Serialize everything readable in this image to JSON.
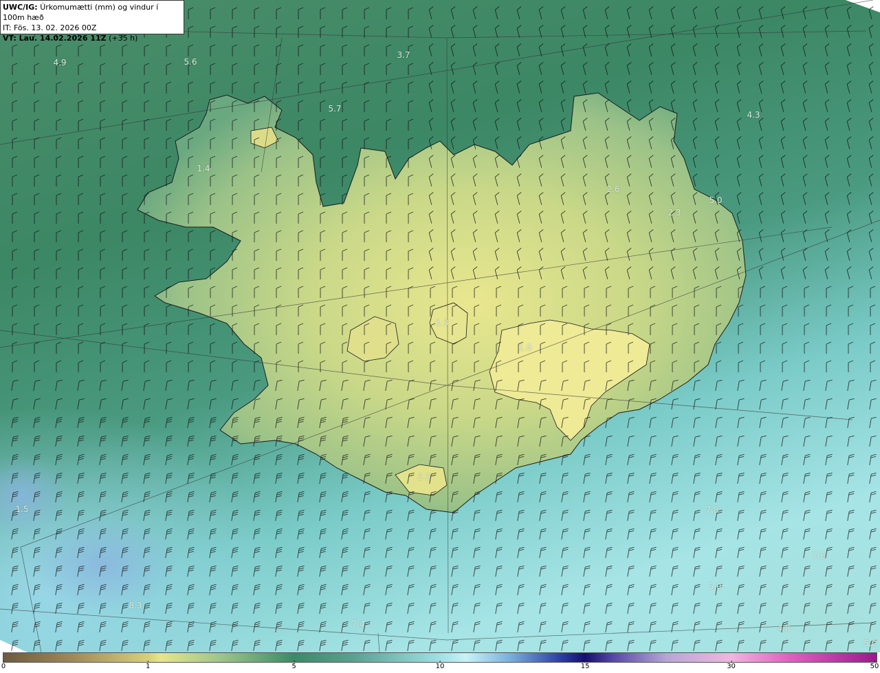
{
  "title": {
    "product": "UWC/IG:",
    "description": "Úrkomumætti (mm) og vindur í 100m hæð",
    "init_time": "IT: Fös. 13. 02. 2026 00Z",
    "valid_prefix": "VT: Lau. 14.02.2026 11Z",
    "valid_suffix": "(+35 h)"
  },
  "value_labels": [
    {
      "text": "4.9"
    },
    {
      "text": "5.6"
    },
    {
      "text": "3.7"
    },
    {
      "text": "5.7"
    },
    {
      "text": "4.3"
    },
    {
      "text": "2.6"
    },
    {
      "text": "5.0"
    },
    {
      "text": "2.3"
    },
    {
      "text": "1.4"
    },
    {
      "text": "1.3"
    },
    {
      "text": "1.0"
    },
    {
      "text": "2.1"
    },
    {
      "text": "7.8"
    },
    {
      "text": "7.6"
    },
    {
      "text": "5.0"
    },
    {
      "text": "7.4"
    },
    {
      "text": "4.8"
    },
    {
      "text": "5.0"
    },
    {
      "text": "1.5"
    },
    {
      "text": "8.3"
    }
  ],
  "colorbar": {
    "ticks": [
      "0",
      "1",
      "5",
      "10",
      "15",
      "30",
      "50"
    ],
    "tick_fractions": [
      0.0,
      0.166,
      0.333,
      0.5,
      0.666,
      0.833,
      1.0
    ]
  },
  "colors": {
    "sea_dark": "#3e8464",
    "land_light": "#e3e58c",
    "sea_cyan": "#a9e6e4",
    "coast_line": "#1a1a1a"
  }
}
